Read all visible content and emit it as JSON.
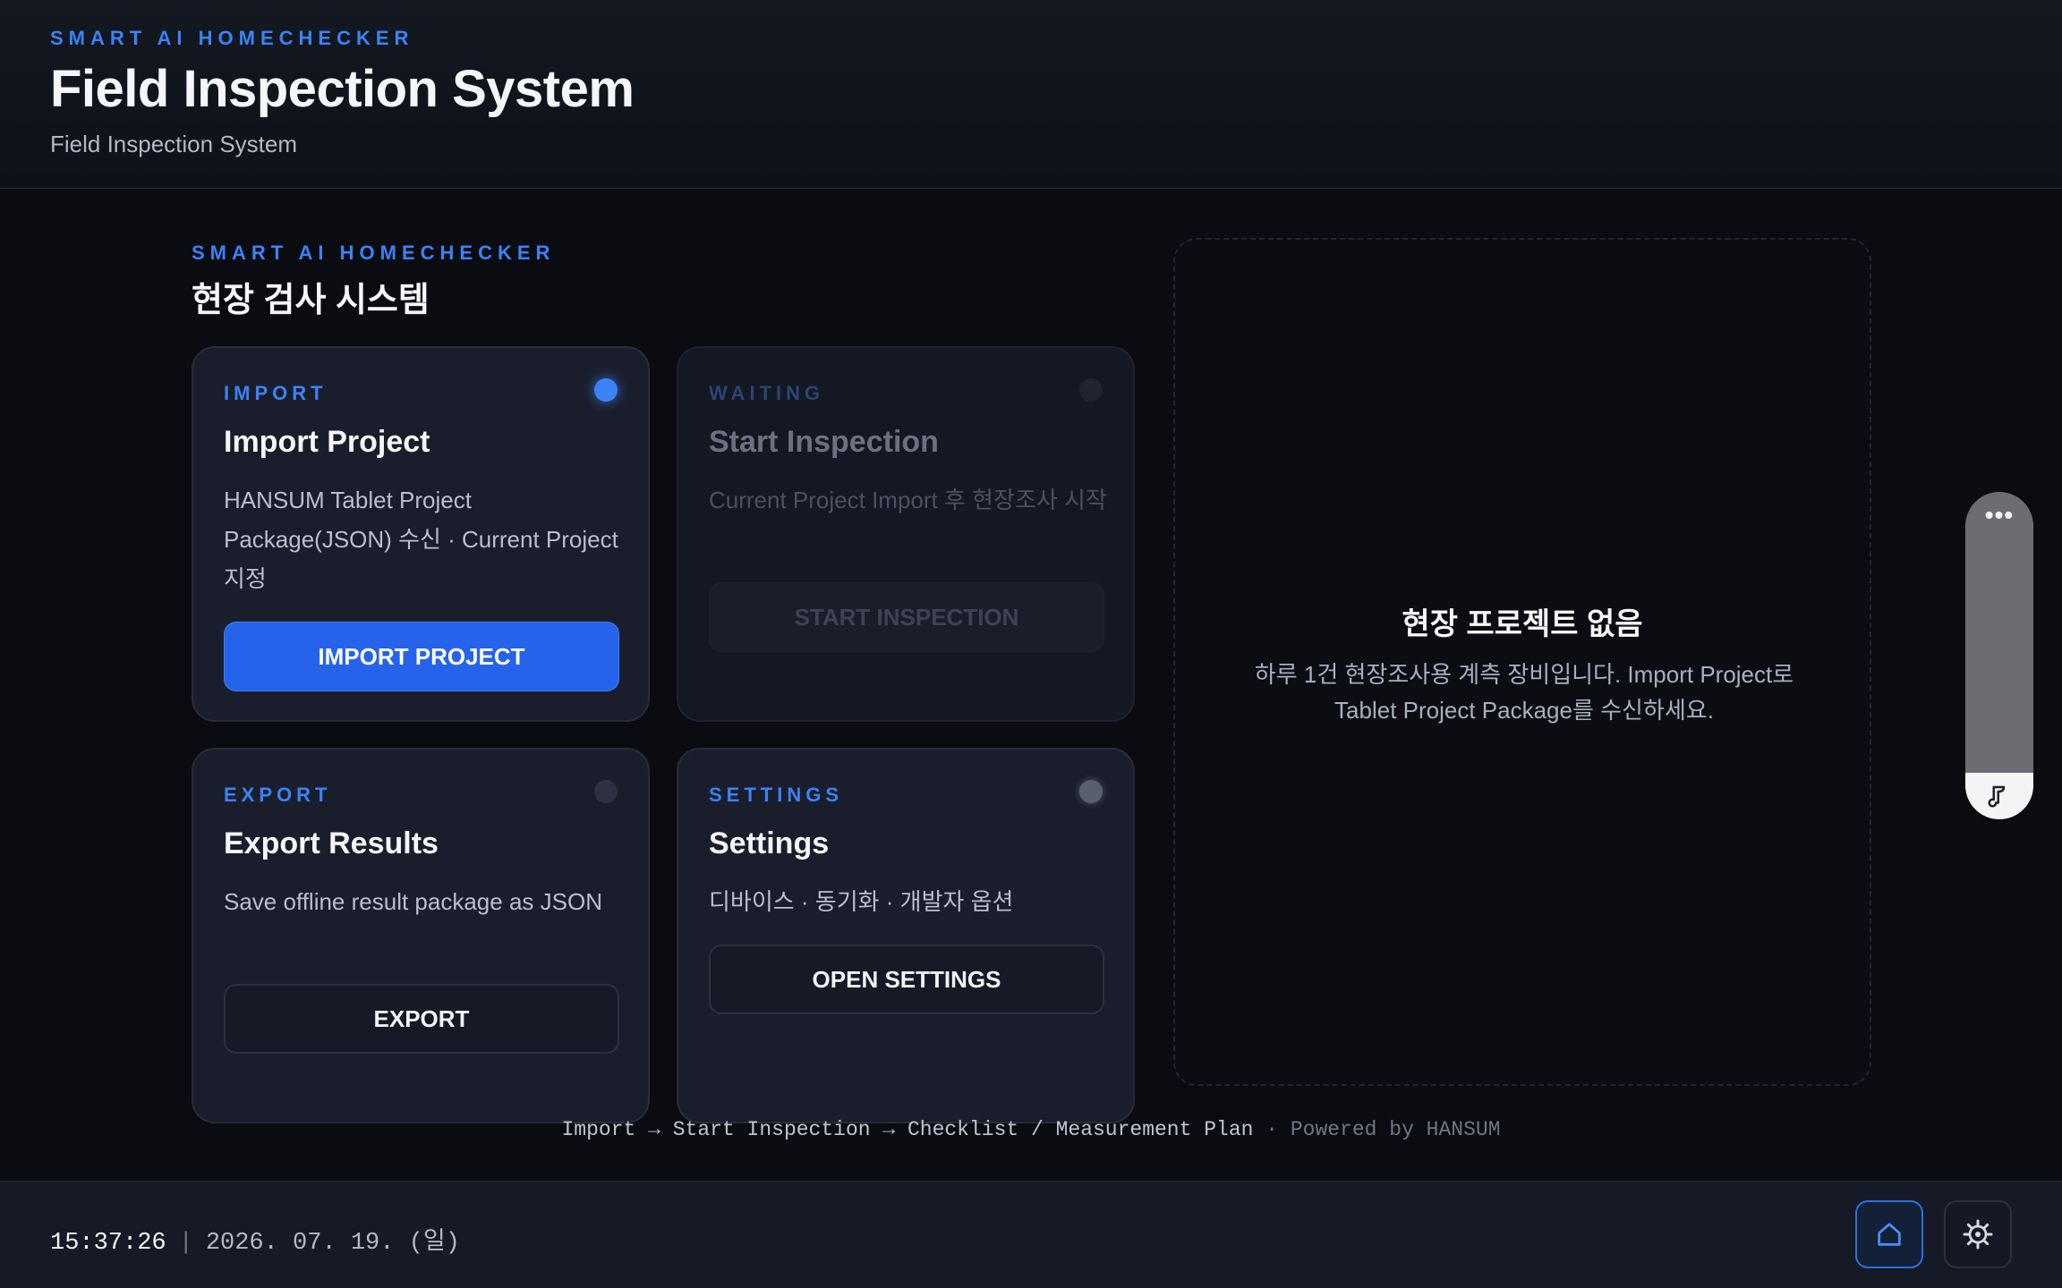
{
  "header": {
    "kicker": "SMART AI HOMECHECKER",
    "title": "Field Inspection System",
    "subtitle": "Field Inspection System"
  },
  "section": {
    "kicker": "SMART AI HOMECHECKER",
    "title": "현장 검사 시스템"
  },
  "cards": {
    "import": {
      "kicker": "IMPORT",
      "title": "Import Project",
      "description": "HANSUM Tablet Project Package(JSON) 수신 · Current Project 지정",
      "button": "IMPORT PROJECT",
      "status": "active"
    },
    "start": {
      "kicker": "WAITING",
      "title": "Start Inspection",
      "description": "Current Project Import 후 현장조사 시작",
      "button": "START INSPECTION",
      "status": "disabled"
    },
    "export": {
      "kicker": "EXPORT",
      "title": "Export Results",
      "description": "Save offline result package as JSON",
      "button": "EXPORT",
      "status": "idle"
    },
    "settings": {
      "kicker": "SETTINGS",
      "title": "Settings",
      "description": "디바이스 · 동기화 · 개발자 옵션",
      "button": "OPEN SETTINGS",
      "status": "idle"
    }
  },
  "panel": {
    "title": "현장 프로젝트 없음",
    "description": "하루 1건 현장조사용 계측 장비입니다. Import Project로 Tablet Project Package를 수신하세요."
  },
  "flow": {
    "steps": "Import → Start Inspection → Checklist / Measurement Plan",
    "separator": " · ",
    "powered": "Powered by HANSUM"
  },
  "statusbar": {
    "time": "15:37:26",
    "separator": "|",
    "date": "2026. 07. 19. (일)"
  },
  "side_handle": {
    "dots": "•••"
  },
  "colors": {
    "accent": "#3b82f6",
    "primary_button": "#2563eb",
    "background": "#0a0c11",
    "card": "#1a1e2c"
  },
  "icons": {
    "home": "home-icon",
    "settings": "gear-icon",
    "handle": "music-note-icon"
  }
}
